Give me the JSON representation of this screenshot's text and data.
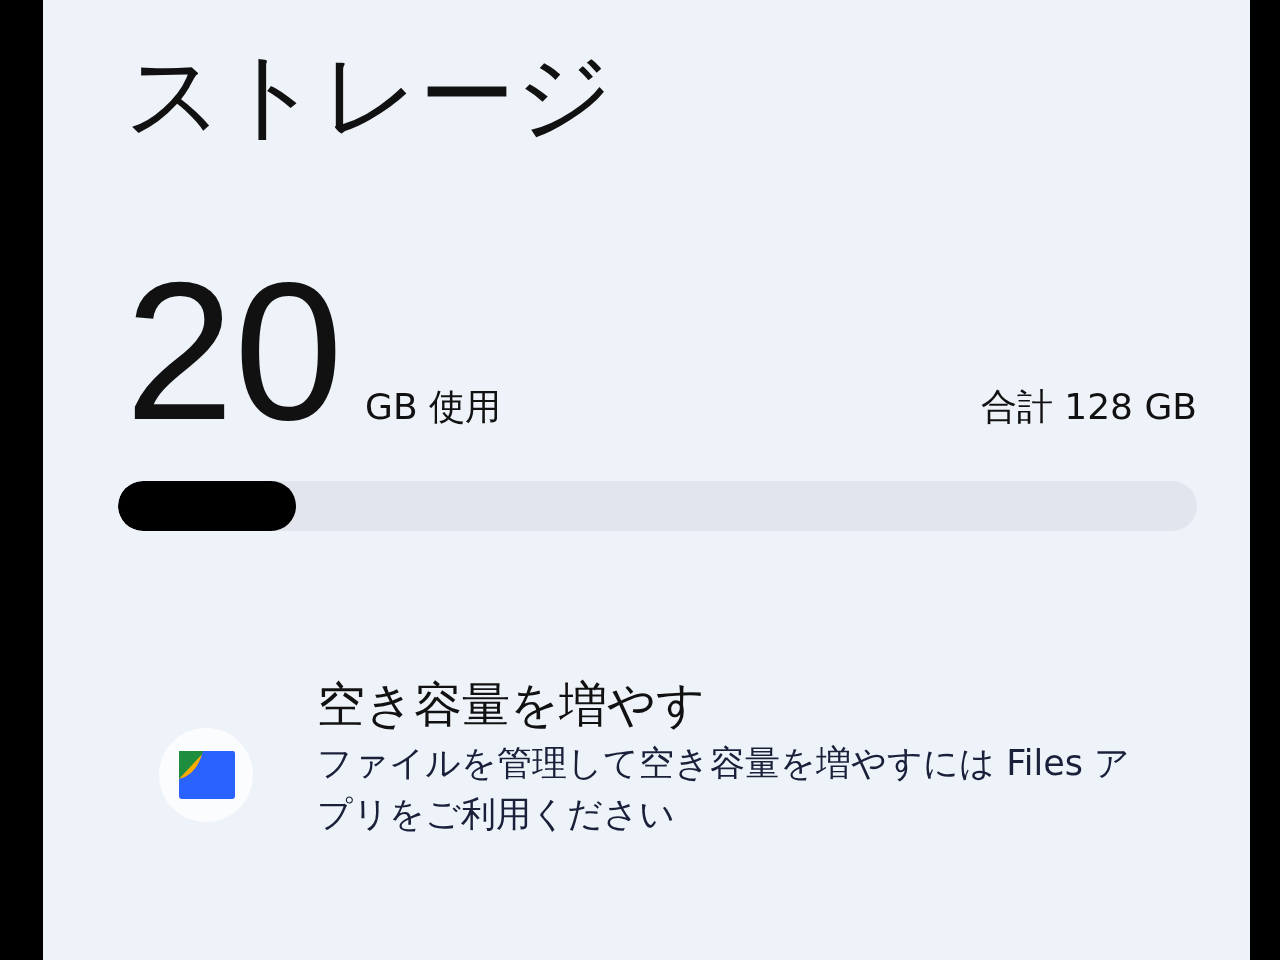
{
  "title": "ストレージ",
  "usage": {
    "used_value": "20",
    "used_unit": "GB 使用",
    "total": "合計 128 GB",
    "level": 0.165
  },
  "suggestion": {
    "title": "空き容量を増やす",
    "description": "ファイルを管理して空き容量を増やすには Files アプリをご利用ください"
  }
}
